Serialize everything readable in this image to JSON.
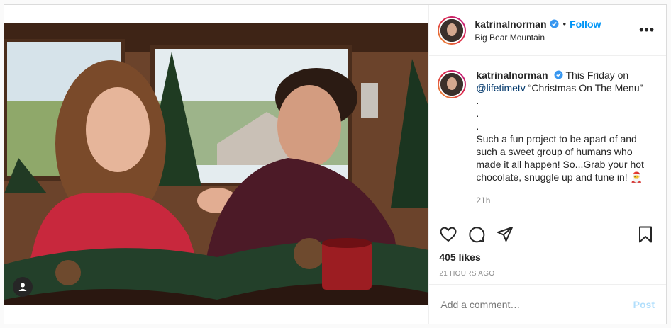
{
  "header": {
    "username": "katrinalnorman",
    "separator": "•",
    "follow_label": "Follow",
    "location": "Big Bear Mountain",
    "more_label": "•••"
  },
  "caption": {
    "username": "katrinalnorman",
    "text_before": "This Friday on",
    "mention": "@lifetimetv",
    "text_after": "“Christmas On The Menu”",
    "dots": [
      ".",
      ".",
      "."
    ],
    "body": "Such a fun project to be apart of and such a sweet group of humans who made it all happen! So...Grab your hot chocolate, snuggle up and tune in! 🎅",
    "time": "21h"
  },
  "actions": {
    "likes": "405 likes",
    "timestamp": "21 HOURS AGO"
  },
  "comment": {
    "placeholder": "Add a comment…",
    "post_label": "Post"
  },
  "colors": {
    "accent": "#0095f6",
    "post_disabled": "#b2dffc",
    "border": "#dbdbdb"
  },
  "icons": [
    "user-tag-icon",
    "verified-icon",
    "more-icon",
    "heart-icon",
    "comment-icon",
    "share-icon",
    "bookmark-icon"
  ]
}
